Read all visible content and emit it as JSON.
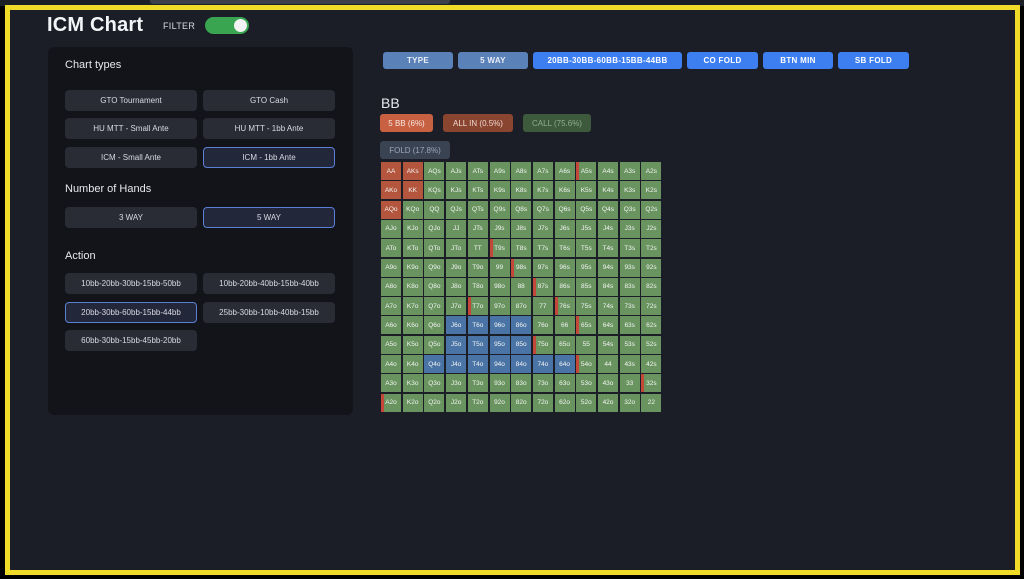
{
  "app": {
    "title": "ICM Chart",
    "filter_label": "FILTER",
    "filter_on": true
  },
  "colors": {
    "frame": "#f0dc28",
    "call": "#69945f",
    "fold": "#4a74a5",
    "bb": "#b4563d",
    "all_in": "#8f3e2c",
    "accent": "#3d7ef0"
  },
  "left_panel": {
    "chart_types_title": "Chart types",
    "chart_types": [
      {
        "label": "GTO Tournament",
        "selected": false
      },
      {
        "label": "GTO Cash",
        "selected": false
      },
      {
        "label": "HU MTT - Small Ante",
        "selected": false
      },
      {
        "label": "HU MTT - 1bb Ante",
        "selected": false
      },
      {
        "label": "ICM - Small Ante",
        "selected": false
      },
      {
        "label": "ICM - 1bb Ante",
        "selected": true
      }
    ],
    "hands_title": "Number of Hands",
    "hands": [
      {
        "label": "3 WAY",
        "selected": false
      },
      {
        "label": "5 WAY",
        "selected": true
      }
    ],
    "action_title": "Action",
    "actions": [
      {
        "label": "10bb-20bb-30bb-15bb-50bb",
        "selected": false
      },
      {
        "label": "10bb-20bb-40bb-15bb-40bb",
        "selected": false
      },
      {
        "label": "20bb-30bb-60bb-15bb-44bb",
        "selected": true
      },
      {
        "label": "25bb-30bb-10bb-40bb-15bb",
        "selected": false
      },
      {
        "label": "60bb-30bb-15bb-45bb-20bb",
        "selected": false
      }
    ]
  },
  "pills": [
    "TYPE",
    "5 WAY",
    "20BB-30BB-60BB-15BB-44BB",
    "CO FOLD",
    "BTN MIN",
    "SB FOLD"
  ],
  "position_title": "BB",
  "legend": {
    "bb": "5 BB (6%)",
    "all_in": "ALL IN (0.5%)",
    "call": "CALL (75.6%)",
    "fold": "FOLD (17.8%)"
  },
  "hand_grid": {
    "ranks": [
      "A",
      "K",
      "Q",
      "J",
      "T",
      "9",
      "8",
      "7",
      "6",
      "5",
      "4",
      "3",
      "2"
    ],
    "actions": [
      "BBGGGGGGGEGGG",
      "BBGGGGGGGGGGG",
      "BGGGGGGGGGGGG",
      "GGGGGGGGGGGGG",
      "GGGGGEGGGGGGG",
      "GGGGGGEGGGGGG",
      "GGGGGGGEGGGGG",
      "GGGGEGGGEGGGG",
      "GGGFFFFGGEGGG",
      "GGGFFFFEGGGGG",
      "GGFFFFFFFEGGG",
      "GGGGGGGGGGGGE",
      "EGGGGGGGGGGGG"
    ]
  }
}
